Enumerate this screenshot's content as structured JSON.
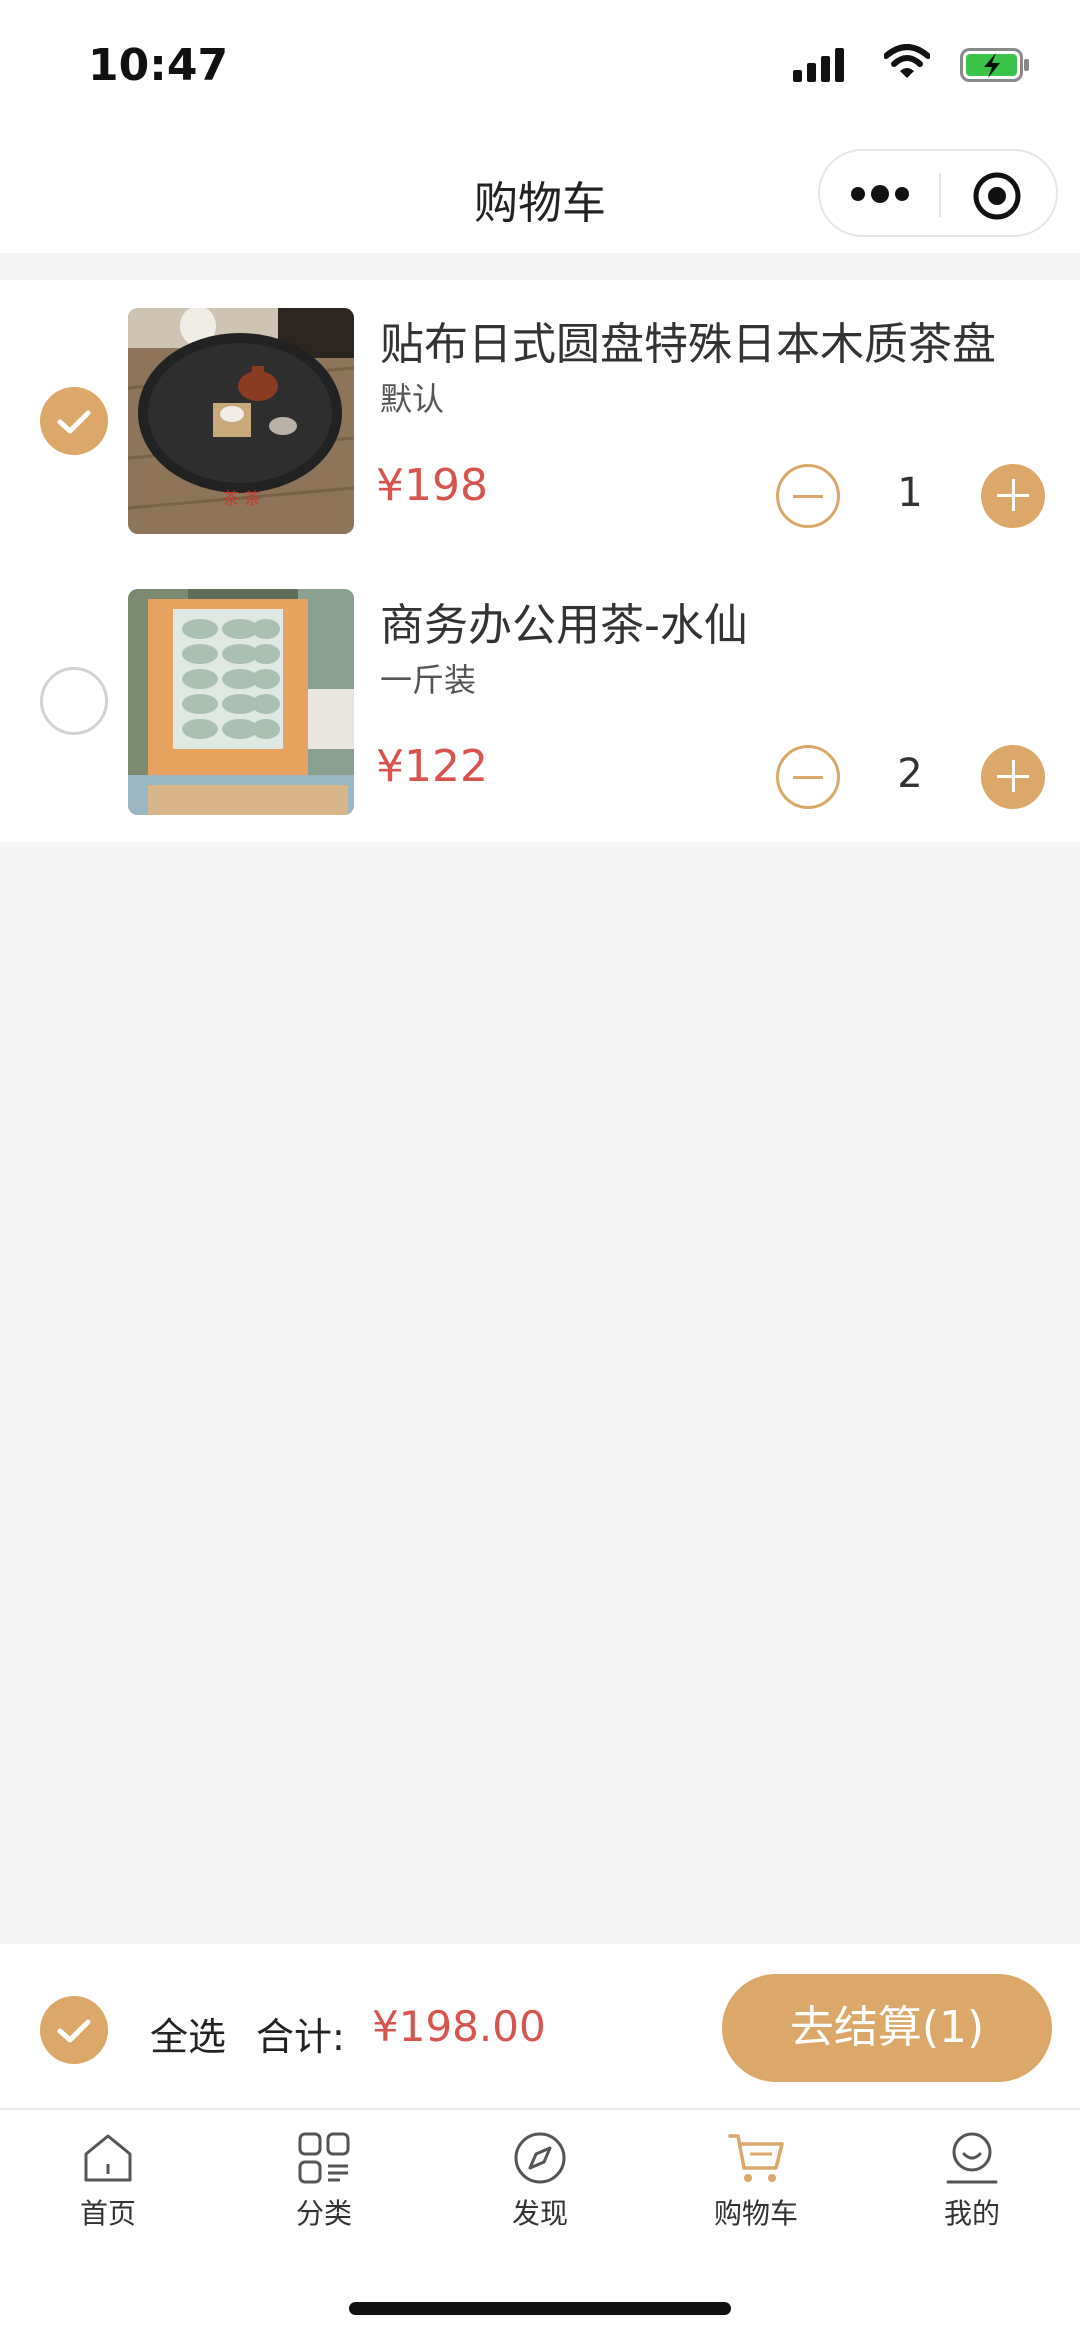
{
  "status_bar": {
    "time": "10:47"
  },
  "header": {
    "title": "购物车"
  },
  "cart": {
    "items": [
      {
        "name": "贴布日式圆盘特殊日本木质茶盘",
        "spec": "默认",
        "price": "¥198",
        "qty": "1",
        "selected": true
      },
      {
        "name": "商务办公用茶-水仙",
        "spec": "一斤装",
        "price": "¥122",
        "qty": "2",
        "selected": false
      }
    ]
  },
  "footer": {
    "select_all": "全选",
    "total_label": "合计:",
    "total_value": "¥198.00",
    "checkout": "去结算(1)"
  },
  "tabbar": {
    "items": [
      {
        "label": "首页",
        "icon": "home-icon"
      },
      {
        "label": "分类",
        "icon": "category-icon"
      },
      {
        "label": "发现",
        "icon": "compass-icon"
      },
      {
        "label": "购物车",
        "icon": "cart-icon",
        "active": true
      },
      {
        "label": "我的",
        "icon": "profile-icon"
      }
    ]
  },
  "colors": {
    "accent": "#dba86a",
    "price": "#d9534f",
    "background": "#f5f5f5"
  }
}
